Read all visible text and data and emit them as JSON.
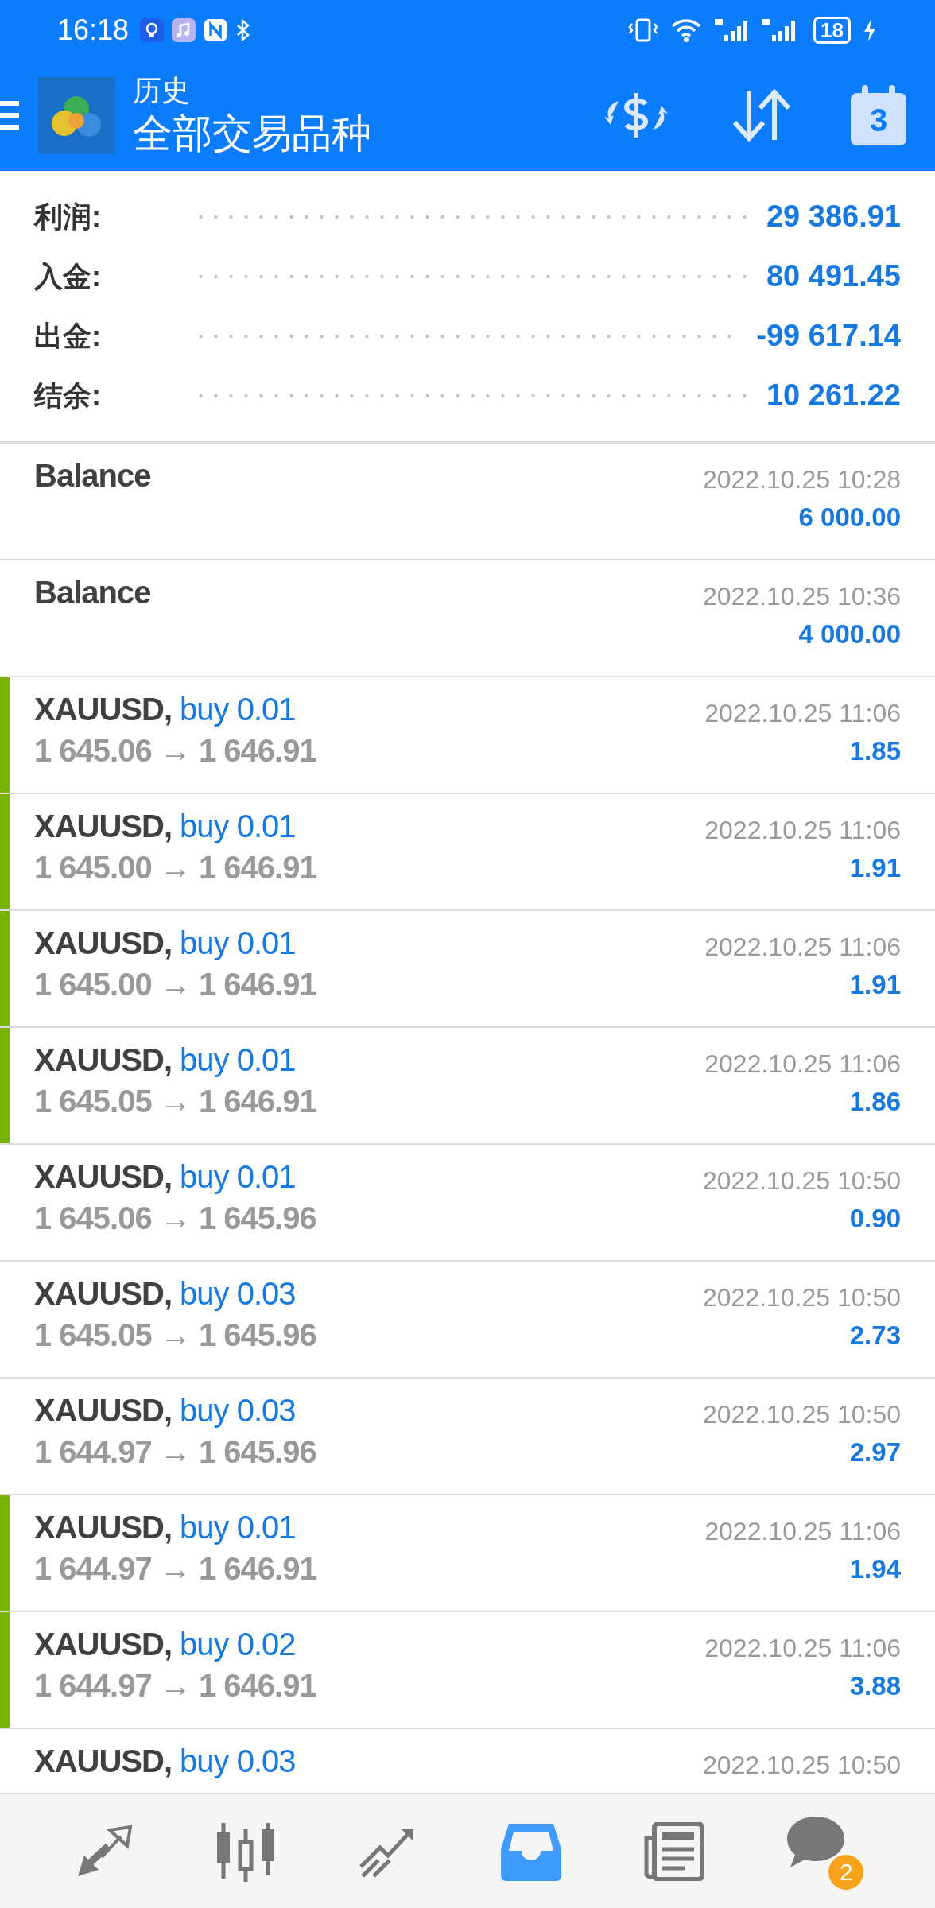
{
  "status_bar": {
    "time": "16:18",
    "battery": "18"
  },
  "header": {
    "title": "历史",
    "subtitle": "全部交易品种",
    "calendar_day": "3"
  },
  "summary": [
    {
      "label": "利润:",
      "value": "29 386.91"
    },
    {
      "label": "入金:",
      "value": "80 491.45"
    },
    {
      "label": "出金:",
      "value": "-99 617.14"
    },
    {
      "label": "结余:",
      "value": "10 261.22"
    }
  ],
  "entries": [
    {
      "kind": "balance",
      "title": "Balance",
      "time": "2022.10.25 10:28",
      "amount": "6 000.00"
    },
    {
      "kind": "balance",
      "title": "Balance",
      "time": "2022.10.25 10:36",
      "amount": "4 000.00"
    },
    {
      "kind": "trade",
      "symbol": "XAUUSD,",
      "side": "buy 0.01",
      "prices": "1 645.06 → 1 646.91",
      "time": "2022.10.25 11:06",
      "amount": "1.85",
      "highlighted": true
    },
    {
      "kind": "trade",
      "symbol": "XAUUSD,",
      "side": "buy 0.01",
      "prices": "1 645.00 → 1 646.91",
      "time": "2022.10.25 11:06",
      "amount": "1.91",
      "highlighted": true
    },
    {
      "kind": "trade",
      "symbol": "XAUUSD,",
      "side": "buy 0.01",
      "prices": "1 645.00 → 1 646.91",
      "time": "2022.10.25 11:06",
      "amount": "1.91",
      "highlighted": true
    },
    {
      "kind": "trade",
      "symbol": "XAUUSD,",
      "side": "buy 0.01",
      "prices": "1 645.05 → 1 646.91",
      "time": "2022.10.25 11:06",
      "amount": "1.86",
      "highlighted": true
    },
    {
      "kind": "trade",
      "symbol": "XAUUSD,",
      "side": "buy 0.01",
      "prices": "1 645.06 → 1 645.96",
      "time": "2022.10.25 10:50",
      "amount": "0.90",
      "highlighted": false
    },
    {
      "kind": "trade",
      "symbol": "XAUUSD,",
      "side": "buy 0.03",
      "prices": "1 645.05 → 1 645.96",
      "time": "2022.10.25 10:50",
      "amount": "2.73",
      "highlighted": false
    },
    {
      "kind": "trade",
      "symbol": "XAUUSD,",
      "side": "buy 0.03",
      "prices": "1 644.97 → 1 645.96",
      "time": "2022.10.25 10:50",
      "amount": "2.97",
      "highlighted": false
    },
    {
      "kind": "trade",
      "symbol": "XAUUSD,",
      "side": "buy 0.01",
      "prices": "1 644.97 → 1 646.91",
      "time": "2022.10.25 11:06",
      "amount": "1.94",
      "highlighted": true
    },
    {
      "kind": "trade",
      "symbol": "XAUUSD,",
      "side": "buy 0.02",
      "prices": "1 644.97 → 1 646.91",
      "time": "2022.10.25 11:06",
      "amount": "3.88",
      "highlighted": true
    },
    {
      "kind": "trade",
      "symbol": "XAUUSD,",
      "side": "buy 0.03",
      "time": "2022.10.25 10:50",
      "highlighted": false
    }
  ],
  "nav": [
    {
      "kind": "quotes",
      "selected": false
    },
    {
      "kind": "chart",
      "selected": false
    },
    {
      "kind": "trade",
      "selected": false
    },
    {
      "kind": "history",
      "selected": true
    },
    {
      "kind": "news",
      "selected": false
    },
    {
      "kind": "chat",
      "selected": false,
      "badge": "2"
    }
  ]
}
